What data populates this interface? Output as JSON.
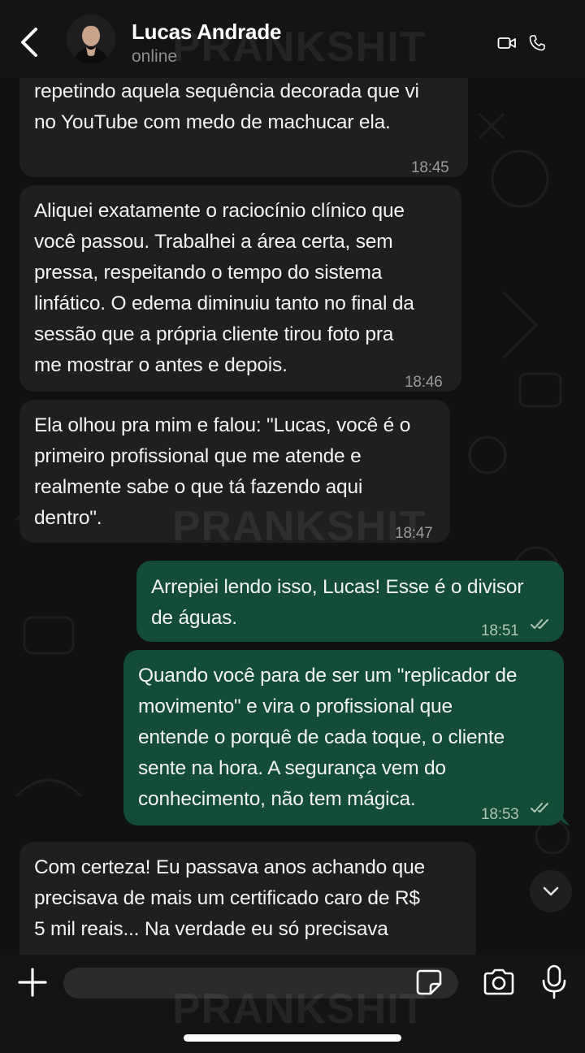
{
  "header": {
    "contact_name": "Lucas Andrade",
    "status": "online"
  },
  "messages": [
    {
      "direction": "in",
      "lines": [
        "repetindo aquela sequência decorada que vi",
        "no YouTube com medo de machucar ela."
      ],
      "time": "18:45"
    },
    {
      "direction": "in",
      "lines": [
        "Aliquei exatamente o raciocínio clínico que",
        "você passou. Trabalhei a área certa, sem",
        "pressa, respeitando o tempo do sistema",
        "linfático. O edema diminuiu tanto no final da",
        "sessão que a própria cliente tirou foto pra",
        "me mostrar o antes e depois."
      ],
      "time": "18:46"
    },
    {
      "direction": "in",
      "lines": [
        "Ela olhou pra mim e falou: \"Lucas, você é o",
        "primeiro profissional que me atende e",
        "realmente sabe o que tá fazendo aqui",
        "dentro\"."
      ],
      "time": "18:47"
    },
    {
      "direction": "out",
      "lines": [
        "Arrepiei lendo isso, Lucas! Esse é o divisor",
        "de águas."
      ],
      "time": "18:51",
      "read": true
    },
    {
      "direction": "out",
      "lines": [
        "Quando você para de ser um \"replicador de",
        "movimento\" e vira o profissional que",
        "entende o porquê de cada toque, o cliente",
        "sente na hora. A segurança vem do",
        "conhecimento, não tem mágica."
      ],
      "time": "18:53",
      "read": true
    },
    {
      "direction": "in",
      "lines": [
        "Com certeza! Eu passava anos achando que",
        "precisava de mais um certificado caro de R$",
        "5 mil reais... Na verdade eu só precisava"
      ],
      "time": ""
    }
  ],
  "watermark": "PRANKSHIT",
  "composer": {
    "placeholder": ""
  },
  "colors": {
    "incoming_bubble": "#1f1f1f",
    "outgoing_bubble": "#144d37",
    "header_bg": "#141414",
    "chat_bg": "#111111"
  },
  "icons": {
    "back": "chevron-left-icon",
    "video": "video-camera-icon",
    "call": "phone-icon",
    "add": "plus-icon",
    "sticker": "sticker-icon",
    "camera": "camera-icon",
    "mic": "microphone-icon",
    "scroll": "chevron-down-icon",
    "read": "double-check-icon"
  }
}
